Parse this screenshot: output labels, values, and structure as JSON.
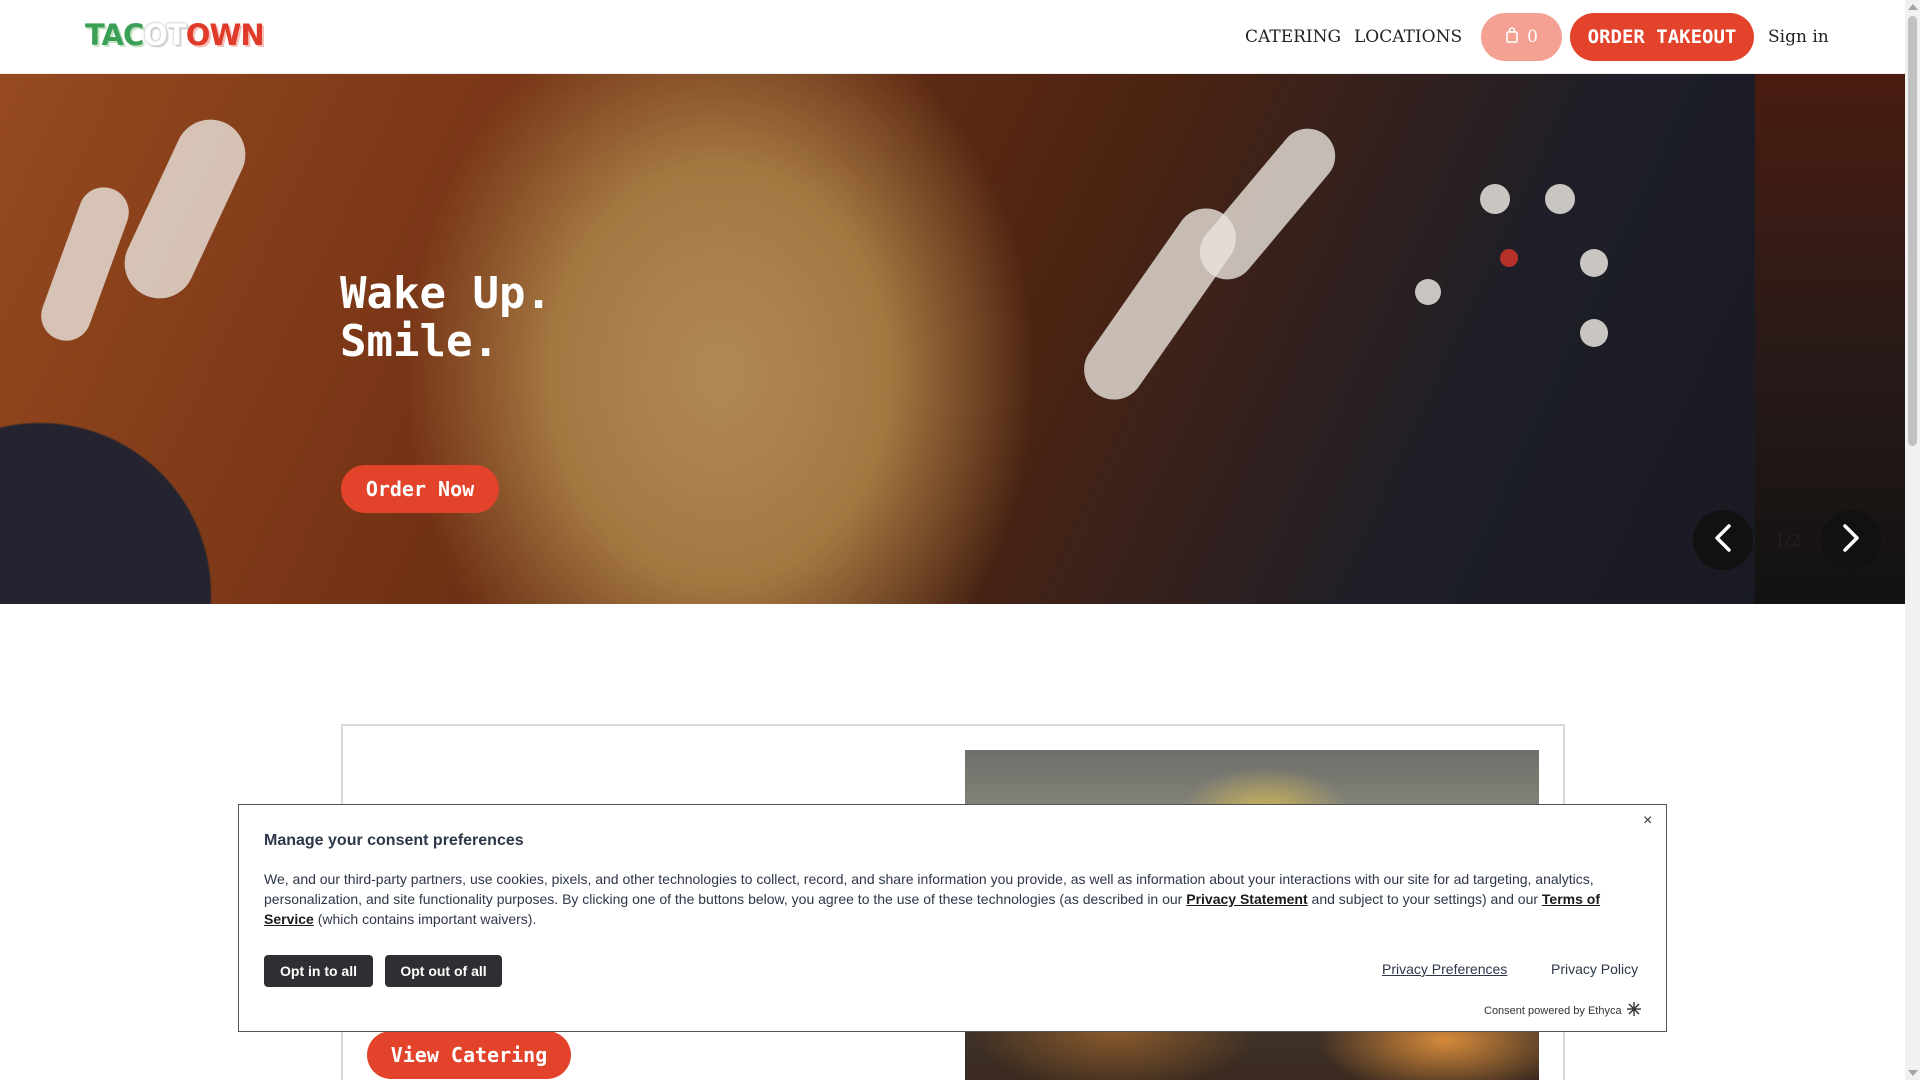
{
  "header": {
    "logo": {
      "part1": "TAC",
      "part2": "O",
      "part3": "T",
      "part4": "OWN"
    },
    "nav": [
      {
        "label": "CATERING"
      },
      {
        "label": "LOCATIONS"
      }
    ],
    "cart_count": "0",
    "order_takeout_label": "ORDER TAKEOUT",
    "sign_in_label": "Sign in"
  },
  "hero": {
    "title_line1": "Wake Up.",
    "title_line2": "Smile.",
    "cta_label": "Order Now",
    "slide_counter": "1/2"
  },
  "catering": {
    "cta_label": "View Catering"
  },
  "consent": {
    "title": "Manage your consent preferences",
    "body_part1": "We, and our third-party partners, use cookies, pixels, and other technologies to collect, record, and share information you provide, as well as information about your interactions with our site for ad targeting, analytics, personalization, and site functionality purposes. By clicking one of the buttons below, you agree to the use of these technologies (as described in our ",
    "privacy_statement_link": "Privacy Statement",
    "body_part2": " and subject to your settings) and our ",
    "terms_link": "Terms of Service",
    "body_part3": " (which contains important waivers).",
    "opt_in_label": "Opt in to all",
    "opt_out_label": "Opt out of all",
    "privacy_preferences_label": "Privacy Preferences",
    "privacy_policy_label": "Privacy Policy",
    "powered_by": "Consent powered by Ethyca",
    "close_symbol": "×"
  },
  "colors": {
    "brand_red": "#e3432b",
    "cart_pink": "#f4a194",
    "logo_green": "#3aa055",
    "dark_button": "#2d2f33"
  },
  "icons": [
    "shopping-bag-icon",
    "chevron-left-icon",
    "chevron-right-icon",
    "close-icon",
    "ethyca-logo-icon"
  ]
}
